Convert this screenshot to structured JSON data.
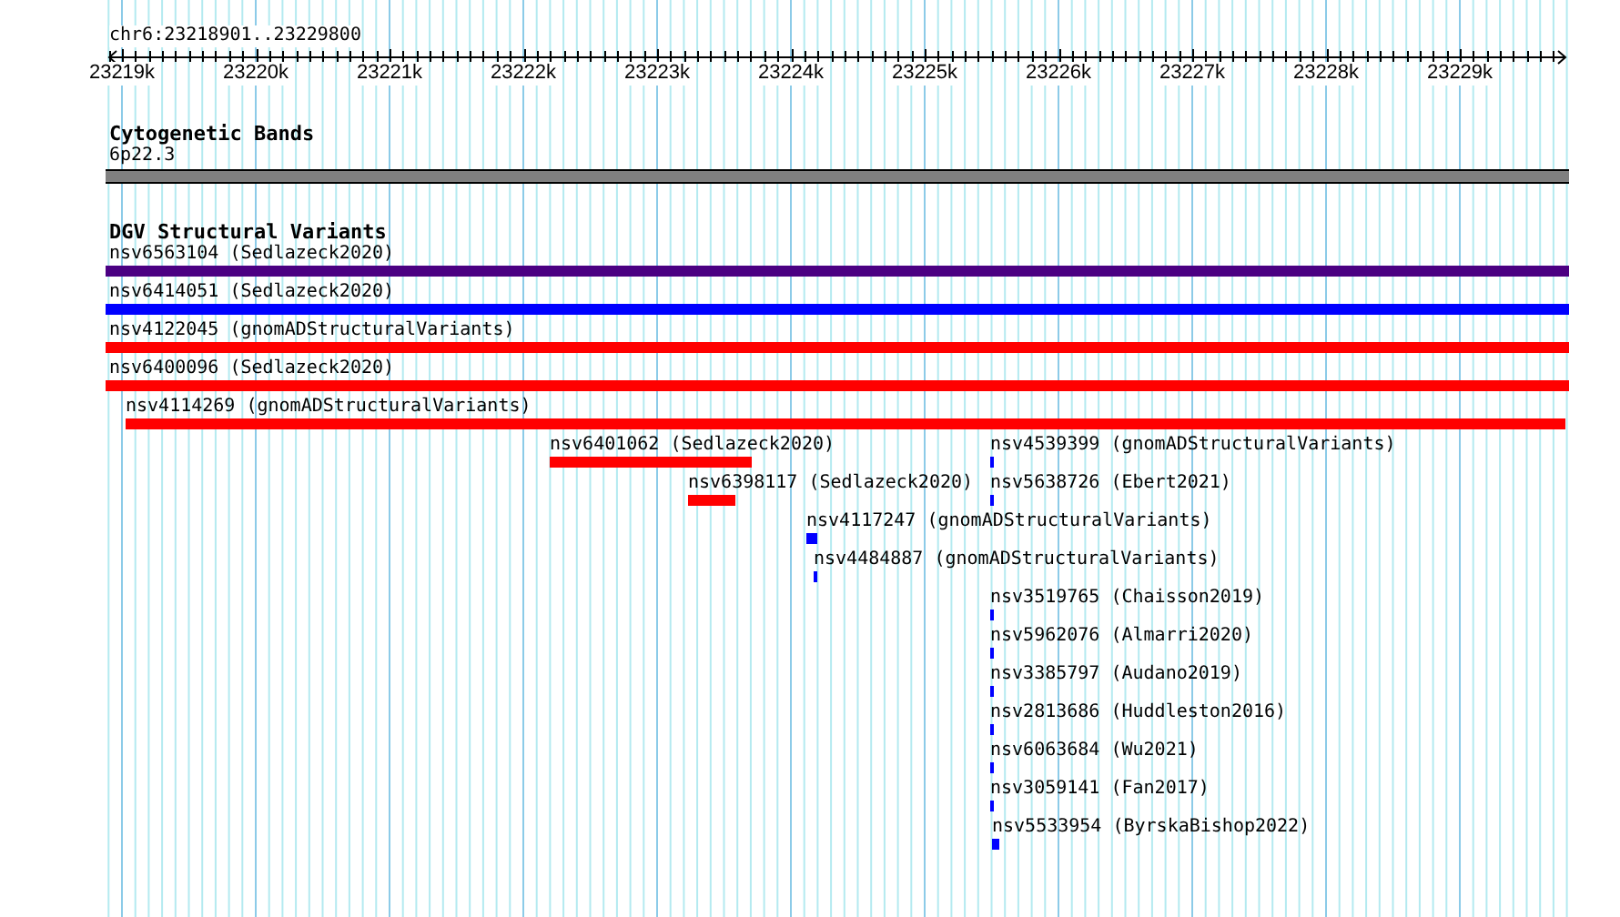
{
  "locus": "chr6:23218901..23229800",
  "ruler": {
    "ticks": [
      "23219k",
      "23220k",
      "23221k",
      "23222k",
      "23223k",
      "23224k",
      "23225k",
      "23226k",
      "23227k",
      "23228k",
      "23229k"
    ]
  },
  "tracks": [
    {
      "kind": "cytoband",
      "title": "Cytogenetic Bands",
      "bands": [
        {
          "name": "6p22.3"
        }
      ]
    },
    {
      "kind": "variants",
      "title": "DGV Structural Variants",
      "features": [
        {
          "name": "nsv6563104 (Sedlazeck2020)",
          "color": "#4b0082"
        },
        {
          "name": "nsv6414051 (Sedlazeck2020)",
          "color": "#0000ff"
        },
        {
          "name": "nsv4122045 (gnomADStructuralVariants)",
          "color": "#ff0000"
        },
        {
          "name": "nsv6400096 (Sedlazeck2020)",
          "color": "#ff0000"
        },
        {
          "name": "nsv4114269 (gnomADStructuralVariants)",
          "color": "#ff0000"
        },
        {
          "name": "nsv6401062 (Sedlazeck2020)",
          "color": "#ff0000"
        },
        {
          "name": "nsv4539399 (gnomADStructuralVariants)",
          "color": "#0000ff"
        },
        {
          "name": "nsv6398117 (Sedlazeck2020)",
          "color": "#ff0000"
        },
        {
          "name": "nsv5638726 (Ebert2021)",
          "color": "#0000ff"
        },
        {
          "name": "nsv4117247 (gnomADStructuralVariants)",
          "color": "#0000ff"
        },
        {
          "name": "nsv4484887 (gnomADStructuralVariants)",
          "color": "#0000ff"
        },
        {
          "name": "nsv3519765 (Chaisson2019)",
          "color": "#0000ff"
        },
        {
          "name": "nsv5962076 (Almarri2020)",
          "color": "#0000ff"
        },
        {
          "name": "nsv3385797 (Audano2019)",
          "color": "#0000ff"
        },
        {
          "name": "nsv2813686 (Huddleston2016)",
          "color": "#0000ff"
        },
        {
          "name": "nsv6063684 (Wu2021)",
          "color": "#0000ff"
        },
        {
          "name": "nsv3059141 (Fan2017)",
          "color": "#0000ff"
        },
        {
          "name": "nsv5533954 (ByrskaBishop2022)",
          "color": "#0000ff"
        }
      ]
    }
  ]
}
